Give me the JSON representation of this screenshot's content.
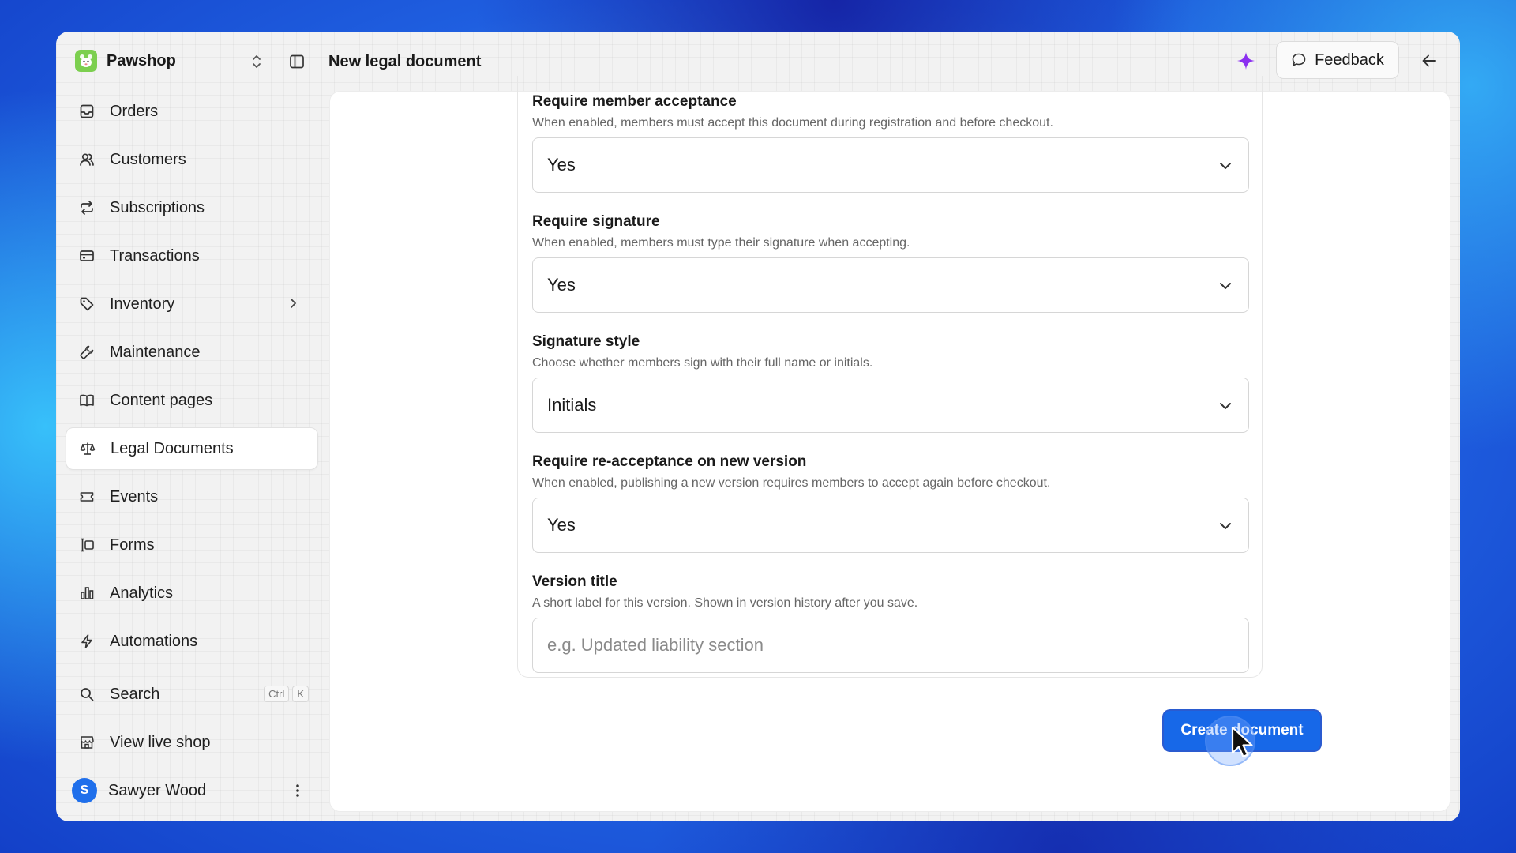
{
  "brand": {
    "name": "Pawshop",
    "logo_icon": "pet-face-icon",
    "accent": "#7ccf4f"
  },
  "header": {
    "title": "New legal document",
    "feedback_label": "Feedback"
  },
  "sidebar": {
    "items": [
      {
        "label": "Orders",
        "icon": "inbox-icon"
      },
      {
        "label": "Customers",
        "icon": "users-icon"
      },
      {
        "label": "Subscriptions",
        "icon": "repeat-icon"
      },
      {
        "label": "Transactions",
        "icon": "credit-card-icon"
      },
      {
        "label": "Inventory",
        "icon": "tag-icon"
      },
      {
        "label": "Maintenance",
        "icon": "wrench-icon"
      },
      {
        "label": "Content pages",
        "icon": "book-open-icon"
      },
      {
        "label": "Legal Documents",
        "icon": "scale-icon",
        "active": true
      },
      {
        "label": "Events",
        "icon": "ticket-icon"
      },
      {
        "label": "Forms",
        "icon": "form-icon"
      },
      {
        "label": "Analytics",
        "icon": "bar-chart-icon"
      },
      {
        "label": "Automations",
        "icon": "lightning-icon"
      }
    ],
    "search": {
      "label": "Search",
      "shortcut_1": "Ctrl",
      "shortcut_2": "K"
    },
    "view_shop": {
      "label": "View live shop"
    },
    "user": {
      "name": "Sawyer Wood",
      "initial": "S",
      "avatar_color": "#1f6feb"
    }
  },
  "form": {
    "fields": [
      {
        "label": "Require member acceptance",
        "help": "When enabled, members must accept this document during registration and before checkout.",
        "value": "Yes"
      },
      {
        "label": "Require signature",
        "help": "When enabled, members must type their signature when accepting.",
        "value": "Yes"
      },
      {
        "label": "Signature style",
        "help": "Choose whether members sign with their full name or initials.",
        "value": "Initials"
      },
      {
        "label": "Require re-acceptance on new version",
        "help": "When enabled, publishing a new version requires members to accept again before checkout.",
        "value": "Yes"
      }
    ],
    "version_title": {
      "label": "Version title",
      "help": "A short label for this version. Shown in version history after you save.",
      "placeholder": "e.g. Updated liability section"
    },
    "submit_label": "Create document",
    "primary_color": "#1768e8"
  }
}
